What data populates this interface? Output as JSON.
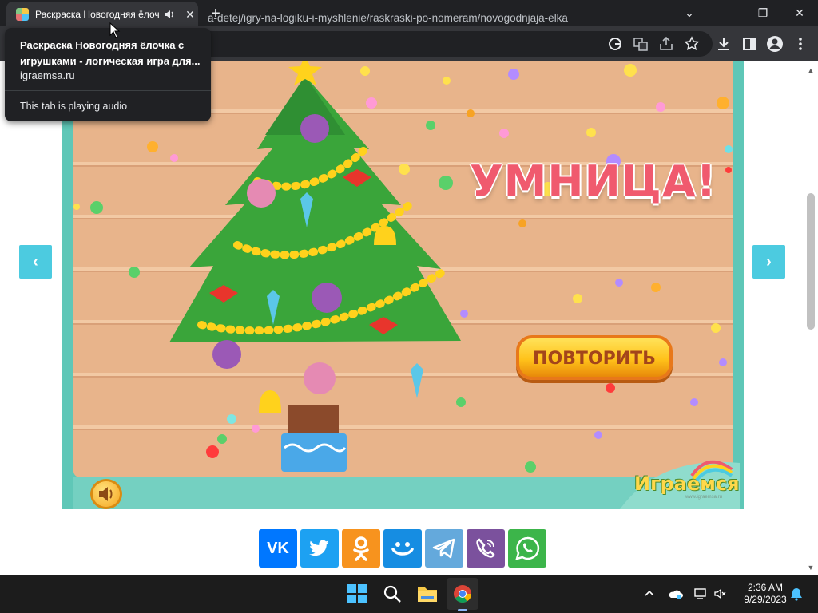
{
  "browser": {
    "tab_title": "Раскраска Новогодняя ёлочка с игрушками - логическая игра для детей",
    "tab_close": "✕",
    "new_tab": "+",
    "url": "a-detej/igry-na-logiku-i-myshlenie/raskraski-po-nomeram/novogodnjaja-elka",
    "window_controls": [
      "⌄",
      "—",
      "❐",
      "✕"
    ],
    "toolbar_icons": [
      "google-lens-icon",
      "translate-icon",
      "share-icon",
      "bookmark-star-icon",
      "download-icon",
      "side-panel-icon",
      "profile-icon",
      "menu-icon"
    ]
  },
  "tooltip": {
    "title": "Раскраска Новогодняя ёлочка с игрушками - логическая игра для...",
    "domain": "igraemsa.ru",
    "audio_status": "This tab is playing audio"
  },
  "game": {
    "headline": "УМНИЦА!",
    "repeat_button": "ПОВТОРИТЬ",
    "logo_text": "Играемся",
    "logo_url": "www.igraemsa.ru",
    "prev_arrow": "‹",
    "next_arrow": "›"
  },
  "share": [
    {
      "name": "vk",
      "label": "VK",
      "color": "#0077ff"
    },
    {
      "name": "twitter",
      "label": "",
      "color": "#1da1f2"
    },
    {
      "name": "odnoklassniki",
      "label": "",
      "color": "#f7931e"
    },
    {
      "name": "moimir",
      "label": "",
      "color": "#168de2"
    },
    {
      "name": "telegram",
      "label": "",
      "color": "#64a9dc"
    },
    {
      "name": "viber",
      "label": "",
      "color": "#7b519d"
    },
    {
      "name": "whatsapp",
      "label": "",
      "color": "#3cb54a"
    }
  ],
  "taskbar": {
    "time": "2:36 AM",
    "date": "9/29/2023",
    "apps": [
      "windows-start-icon",
      "search-icon",
      "file-explorer-icon",
      "chrome-icon"
    ]
  },
  "colors": {
    "chrome_dark": "#202124",
    "chrome_toolbar": "#35363a",
    "frame_teal": "#5fc7b7",
    "arrow_blue": "#4ccbe0",
    "headline_pink": "#f05a6e",
    "button_yellow": "#ffc21a"
  }
}
